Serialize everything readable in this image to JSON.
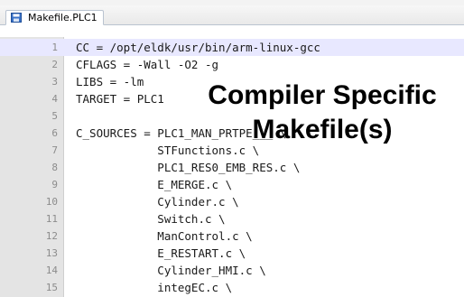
{
  "tab": {
    "icon": "save-icon",
    "label": "Makefile.PLC1"
  },
  "editor": {
    "current_line_color": "#e8e8ff",
    "lines": [
      {
        "num": "1",
        "text": "CC = /opt/eldk/usr/bin/arm-linux-gcc"
      },
      {
        "num": "2",
        "text": "CFLAGS = -Wall -O2 -g"
      },
      {
        "num": "3",
        "text": "LIBS = -lm"
      },
      {
        "num": "4",
        "text": "TARGET = PLC1"
      },
      {
        "num": "5",
        "text": ""
      },
      {
        "num": "6",
        "text": "C_SOURCES = PLC1_MAN_PRTPE___ \\"
      },
      {
        "num": "7",
        "text": "            STFunctions.c \\"
      },
      {
        "num": "8",
        "text": "            PLC1_RES0_EMB_RES.c \\"
      },
      {
        "num": "9",
        "text": "            E_MERGE.c \\"
      },
      {
        "num": "10",
        "text": "            Cylinder.c \\"
      },
      {
        "num": "11",
        "text": "            Switch.c \\"
      },
      {
        "num": "12",
        "text": "            ManControl.c \\"
      },
      {
        "num": "13",
        "text": "            E_RESTART.c \\"
      },
      {
        "num": "14",
        "text": "            Cylinder_HMI.c \\"
      },
      {
        "num": "15",
        "text": "            integEC.c \\"
      }
    ]
  },
  "overlay": {
    "line1": "Compiler Specific",
    "line2": "Makefile(s)"
  }
}
